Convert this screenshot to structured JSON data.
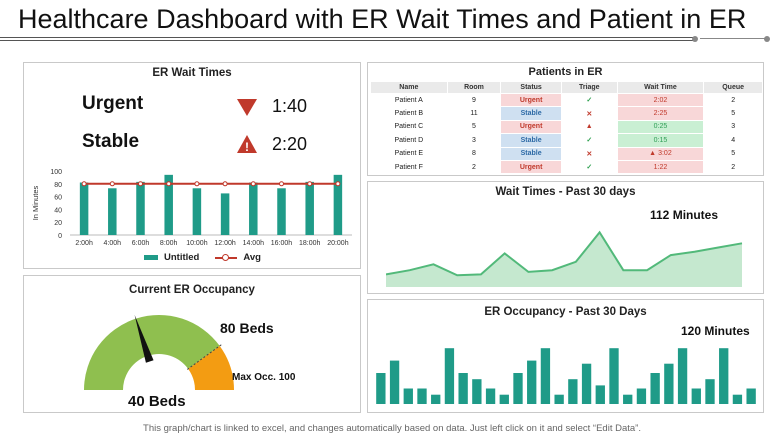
{
  "title": "Healthcare Dashboard with ER Wait Times and Patient in ER",
  "footer": "This graph/chart is linked to excel, and changes automatically based on data. Just left click on it and select “Edit Data”.",
  "colors": {
    "teal": "#1f9b88",
    "avg_red": "#c0392b",
    "gauge_green": "#8fbf4f",
    "gauge_orange": "#f39c12",
    "area_green": "#52b97a",
    "area_fill": "#c5e8cf"
  },
  "er_wait": {
    "title": "ER Wait Times",
    "urgent_label": "Urgent",
    "urgent_time": "1:40",
    "urgent_icon": "down-triangle-icon",
    "stable_label": "Stable",
    "stable_time": "2:20",
    "stable_icon": "warning-icon",
    "warning_glyph": "!",
    "legend_bar": "Untitled",
    "legend_line": "Avg"
  },
  "patients": {
    "title": "Patients in ER",
    "columns": [
      "Name",
      "Room",
      "Status",
      "Triage",
      "Wait Time",
      "Queue"
    ],
    "rows": [
      [
        "Patient A",
        "9",
        "Urgent",
        "check",
        "2:02",
        "2"
      ],
      [
        "Patient B",
        "11",
        "Stable",
        "cross",
        "2:25",
        "5"
      ],
      [
        "Patient C",
        "5",
        "Urgent",
        "warn",
        "0:25",
        "3"
      ],
      [
        "Patient D",
        "3",
        "Stable",
        "check",
        "0:15",
        "4"
      ],
      [
        "Patient E",
        "8",
        "Stable",
        "cross",
        "3:02",
        "5"
      ],
      [
        "Patient F",
        "2",
        "Urgent",
        "check",
        "1:22",
        "2"
      ]
    ],
    "wait_tone": [
      "red",
      "red",
      "green",
      "green",
      "red",
      "red"
    ],
    "wait_warn": [
      false,
      false,
      false,
      false,
      true,
      false
    ],
    "symbols": {
      "check": "✓",
      "cross": "✕",
      "warn": "▲"
    }
  },
  "occupancy": {
    "title": "Current ER Occupancy",
    "value_label": "80 Beds",
    "min_label": "40 Beds",
    "max_label": "Max Occ. 100",
    "max": 100,
    "current": 80,
    "needle": 40
  },
  "wait30": {
    "title": "Wait Times - Past 30 days",
    "annotation": "112 Minutes"
  },
  "occ30": {
    "title": "ER Occupancy - Past 30 Days",
    "annotation": "120 Minutes"
  },
  "chart_data": [
    {
      "type": "bar",
      "title": "ER Wait Times",
      "ylabel": "In Minutes",
      "categories": [
        "2:00h",
        "4:00h",
        "6:00h",
        "8:00h",
        "10:00h",
        "12:00h",
        "14:00h",
        "16:00h",
        "18:00h",
        "20:00h"
      ],
      "series": [
        {
          "name": "Untitled",
          "values": [
            82,
            73,
            83,
            94,
            73,
            65,
            82,
            73,
            83,
            94
          ]
        },
        {
          "name": "Avg",
          "type": "line",
          "values": [
            80,
            80,
            80,
            80,
            80,
            80,
            80,
            80,
            80,
            80
          ]
        }
      ],
      "ylim": [
        0,
        100
      ],
      "yticks": [
        0,
        20,
        40,
        60,
        80,
        100
      ],
      "legend": "bottom"
    },
    {
      "type": "area",
      "title": "Wait Times - Past 30 days",
      "values": [
        15,
        20,
        27,
        14,
        15,
        40,
        18,
        20,
        30,
        65,
        20,
        20,
        38,
        42,
        47,
        52
      ],
      "ylim": [
        0,
        75
      ]
    },
    {
      "type": "bar",
      "title": "ER Occupancy - Past 30 Days",
      "values": [
        50,
        70,
        25,
        25,
        15,
        90,
        50,
        40,
        25,
        15,
        50,
        70,
        90,
        15,
        40,
        65,
        30,
        90,
        15,
        25,
        50,
        65,
        90,
        25,
        40,
        90,
        15,
        25
      ],
      "ylim": [
        0,
        100
      ]
    }
  ]
}
